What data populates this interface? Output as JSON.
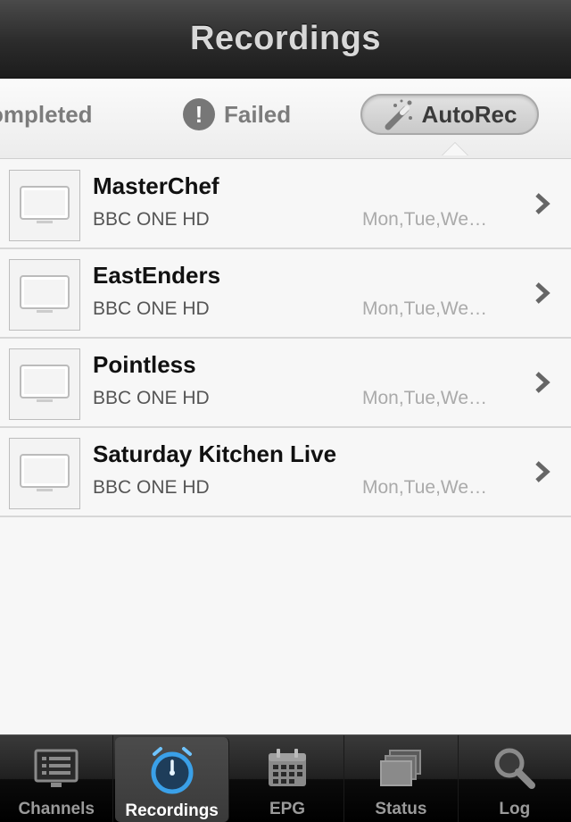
{
  "navbar": {
    "title": "Recordings"
  },
  "segments": {
    "completed": "ompleted",
    "failed": "Failed",
    "autorec": "AutoRec"
  },
  "recordings": [
    {
      "title": "MasterChef",
      "channel": "BBC ONE HD",
      "days": "Mon,Tue,We…"
    },
    {
      "title": "EastEnders",
      "channel": "BBC ONE HD",
      "days": "Mon,Tue,We…"
    },
    {
      "title": "Pointless",
      "channel": "BBC ONE HD",
      "days": "Mon,Tue,We…"
    },
    {
      "title": "Saturday Kitchen Live",
      "channel": "BBC ONE HD",
      "days": "Mon,Tue,We…"
    }
  ],
  "tabbar": {
    "channels": "Channels",
    "recordings": "Recordings",
    "epg": "EPG",
    "status": "Status",
    "log": "Log",
    "active": "recordings"
  },
  "colors": {
    "accent": "#3aa0e8",
    "navbar": "#2b2b2b"
  }
}
